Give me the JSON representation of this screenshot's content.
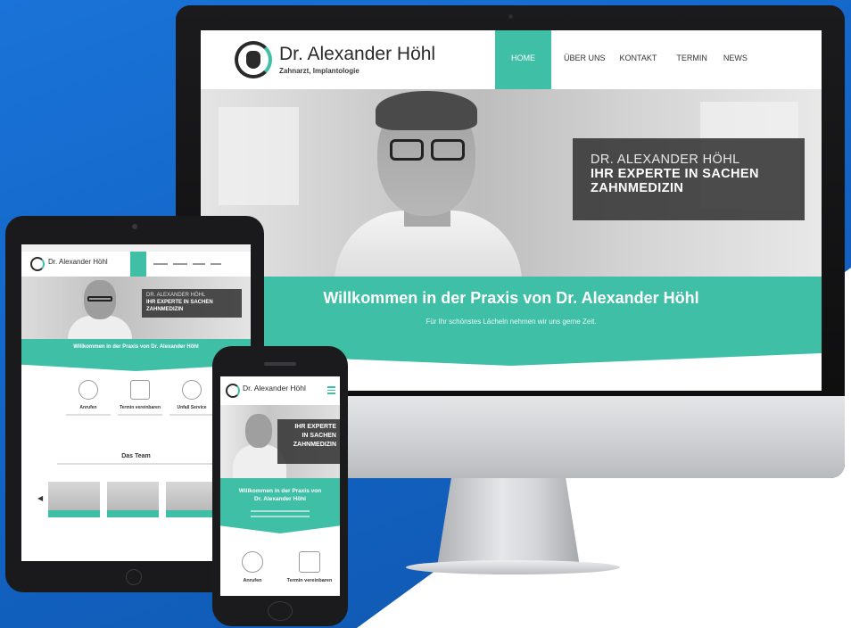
{
  "site": {
    "name": "Dr. Alexander Höhl",
    "subtitle": "Zahnarzt, Implantologie"
  },
  "nav": {
    "items": [
      "HOME",
      "ÜBER UNS",
      "KONTAKT",
      "TERMIN",
      "NEWS"
    ],
    "active": "HOME"
  },
  "hero": {
    "line1": "DR. ALEXANDER HÖHL",
    "line2": "IHR EXPERTE IN SACHEN",
    "line3": "ZAHNMEDIZIN"
  },
  "welcome": {
    "title": "Willkommen in der Praxis von Dr. Alexander Höhl",
    "subtitle": "Für Ihr schönstes Lächeln nehmen wir uns gerne Zeit."
  },
  "phone_hero": {
    "line1": "IHR EXPERTE",
    "line2": "IN SACHEN",
    "line3": "ZAHNMEDIZIN"
  },
  "phone_welcome": {
    "line1": "Willkommen in der Praxis von",
    "line2": "Dr. Alexander Höhl"
  },
  "features": [
    "Anrufen",
    "Termin vereinbaren",
    "Unfall Service"
  ],
  "team": {
    "title": "Das Team"
  },
  "colors": {
    "accent": "#3fbfa6",
    "background": "#1565c0",
    "dark_box": "#343434"
  }
}
